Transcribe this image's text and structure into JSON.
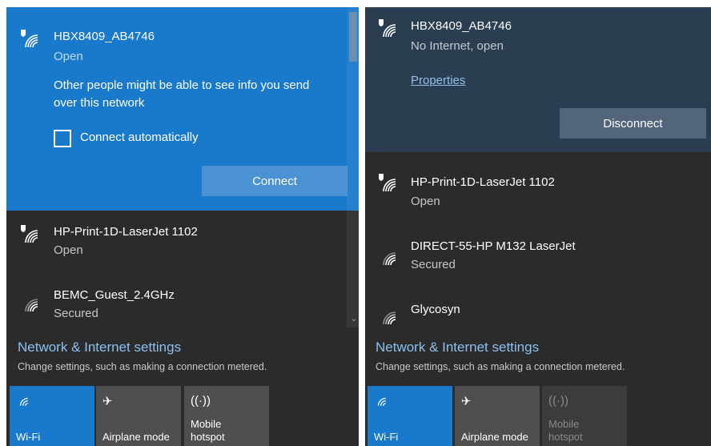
{
  "left": {
    "selected": {
      "ssid": "HBX8409_AB4746",
      "status": "Open",
      "warning": "Other people might be able to see info you send over this network",
      "auto_connect_label": "Connect automatically",
      "connect_label": "Connect"
    },
    "networks": [
      {
        "ssid": "HP-Print-1D-LaserJet 1102",
        "status": "Open"
      },
      {
        "ssid": "BEMC_Guest_2.4GHz",
        "status": "Secured"
      }
    ],
    "settings": {
      "title": "Network & Internet settings",
      "subtitle": "Change settings, such as making a connection metered."
    },
    "tiles": [
      {
        "label": "Wi-Fi",
        "icon": "wifi-icon"
      },
      {
        "label": "Airplane mode",
        "icon": "airplane-icon"
      },
      {
        "label": "Mobile hotspot",
        "icon": "hotspot-icon"
      }
    ]
  },
  "right": {
    "selected": {
      "ssid": "HBX8409_AB4746",
      "status": "No Internet, open",
      "properties_label": "Properties",
      "disconnect_label": "Disconnect"
    },
    "networks": [
      {
        "ssid": "HP-Print-1D-LaserJet 1102",
        "status": "Open"
      },
      {
        "ssid": "DIRECT-55-HP M132 LaserJet",
        "status": "Secured"
      },
      {
        "ssid": "Glycosyn",
        "status": ""
      }
    ],
    "settings": {
      "title": "Network & Internet settings",
      "subtitle": "Change settings, such as making a connection metered."
    },
    "tiles": [
      {
        "label": "Wi-Fi",
        "icon": "wifi-icon"
      },
      {
        "label": "Airplane mode",
        "icon": "airplane-icon"
      },
      {
        "label": "Mobile hotspot",
        "icon": "hotspot-icon"
      }
    ]
  },
  "colors": {
    "accent": "#1979ca",
    "panel_bg": "#2b2b2b",
    "link": "#8bc0f1"
  }
}
